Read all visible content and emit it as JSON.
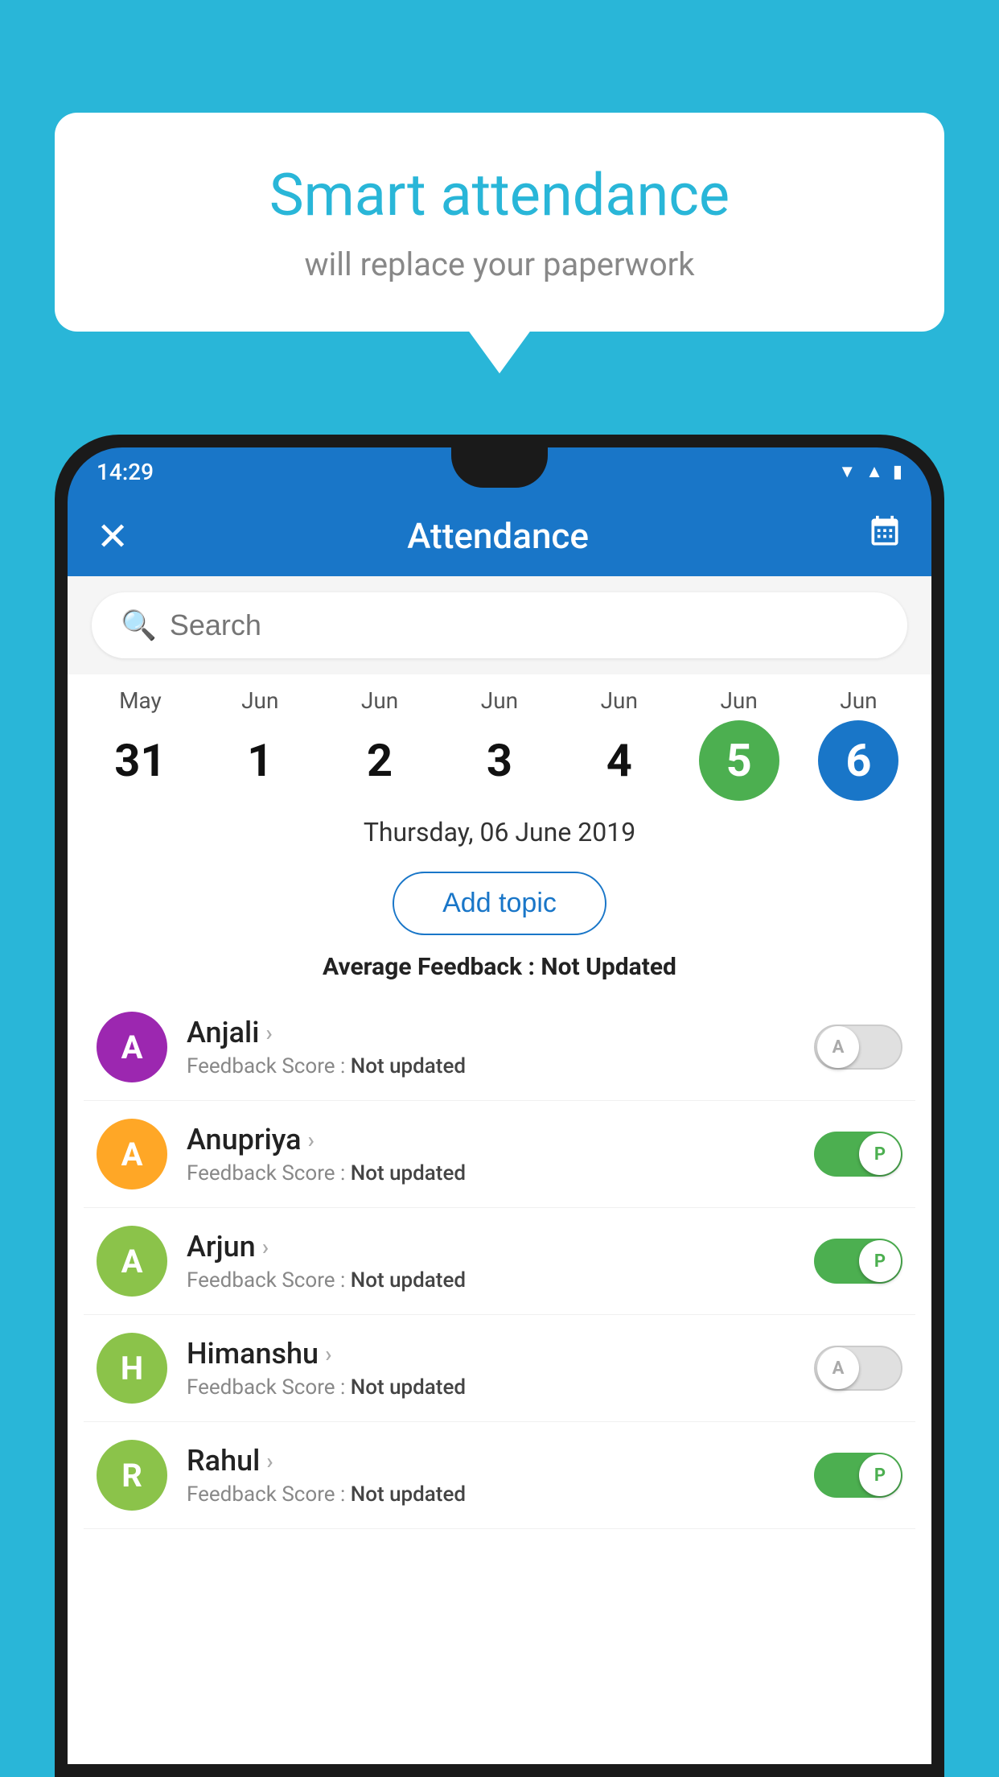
{
  "background": "#29b6d8",
  "bubble": {
    "title": "Smart attendance",
    "subtitle": "will replace your paperwork"
  },
  "statusBar": {
    "time": "14:29",
    "icons": [
      "wifi",
      "signal",
      "battery"
    ]
  },
  "appBar": {
    "title": "Attendance",
    "closeLabel": "✕",
    "calendarLabel": "📅"
  },
  "search": {
    "placeholder": "Search"
  },
  "dates": [
    {
      "month": "May",
      "day": "31",
      "state": "normal"
    },
    {
      "month": "Jun",
      "day": "1",
      "state": "normal"
    },
    {
      "month": "Jun",
      "day": "2",
      "state": "normal"
    },
    {
      "month": "Jun",
      "day": "3",
      "state": "normal"
    },
    {
      "month": "Jun",
      "day": "4",
      "state": "normal"
    },
    {
      "month": "Jun",
      "day": "5",
      "state": "today"
    },
    {
      "month": "Jun",
      "day": "6",
      "state": "selected"
    }
  ],
  "selectedDate": "Thursday, 06 June 2019",
  "addTopicLabel": "Add topic",
  "avgFeedback": {
    "label": "Average Feedback : ",
    "value": "Not Updated"
  },
  "students": [
    {
      "name": "Anjali",
      "avatarLetter": "A",
      "avatarColor": "#9c27b0",
      "feedbackLabel": "Feedback Score : ",
      "feedbackValue": "Not updated",
      "toggleState": "off",
      "toggleLabel": "A"
    },
    {
      "name": "Anupriya",
      "avatarLetter": "A",
      "avatarColor": "#ffa726",
      "feedbackLabel": "Feedback Score : ",
      "feedbackValue": "Not updated",
      "toggleState": "on",
      "toggleLabel": "P"
    },
    {
      "name": "Arjun",
      "avatarLetter": "A",
      "avatarColor": "#8bc34a",
      "feedbackLabel": "Feedback Score : ",
      "feedbackValue": "Not updated",
      "toggleState": "on",
      "toggleLabel": "P"
    },
    {
      "name": "Himanshu",
      "avatarLetter": "H",
      "avatarColor": "#8bc34a",
      "feedbackLabel": "Feedback Score : ",
      "feedbackValue": "Not updated",
      "toggleState": "off",
      "toggleLabel": "A"
    },
    {
      "name": "Rahul",
      "avatarLetter": "R",
      "avatarColor": "#8bc34a",
      "feedbackLabel": "Feedback Score : ",
      "feedbackValue": "Not updated",
      "toggleState": "on",
      "toggleLabel": "P"
    }
  ]
}
